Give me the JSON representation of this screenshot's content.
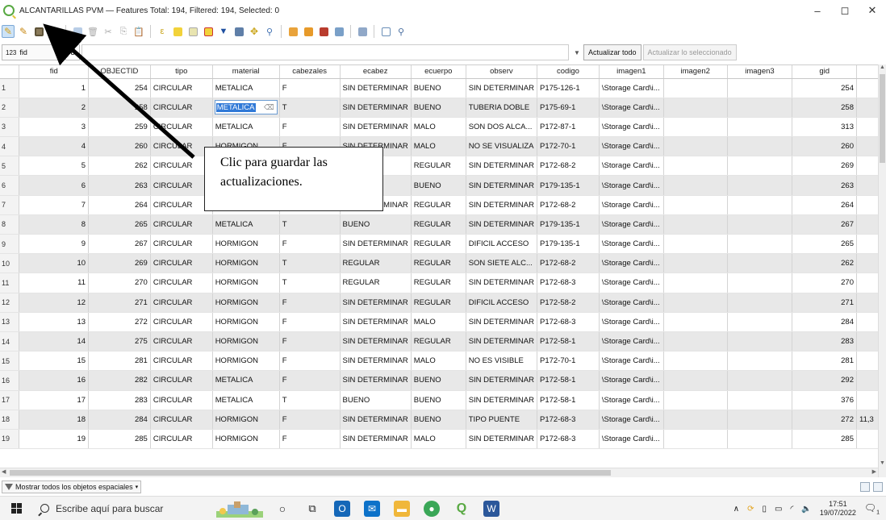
{
  "window": {
    "title": "ALCANTARILLAS PVM — Features Total: 194, Filtered: 194, Selected: 0",
    "minimize": "–",
    "maximize": "◻",
    "close": "✕"
  },
  "expression_bar": {
    "field_type": "123",
    "field_name": "fid",
    "epsilon": "ε",
    "update_all": "Actualizar todo",
    "update_selected": "Actualizar lo seleccionado"
  },
  "table": {
    "columns": [
      "fid",
      "OBJECTID",
      "tipo",
      "material",
      "cabezales",
      "ecabez",
      "ecuerpo",
      "observ",
      "codigo",
      "imagen1",
      "imagen2",
      "imagen3",
      "gid",
      ""
    ],
    "rows": [
      {
        "n": "1",
        "fid": "1",
        "objectid": "254",
        "tipo": "CIRCULAR",
        "material": "METALICA",
        "cabezales": "F",
        "ecabez": "SIN DETERMINAR",
        "ecuerpo": "BUENO",
        "observ": "SIN DETERMINAR",
        "codigo": "P175-126-1",
        "imagen1": "\\Storage Card\\i...",
        "gid": "254",
        "extra": ""
      },
      {
        "n": "2",
        "fid": "2",
        "objectid": "258",
        "tipo": "CIRCULAR",
        "material": "METALICA",
        "cabezales": "T",
        "ecabez": "SIN DETERMINAR",
        "ecuerpo": "BUENO",
        "observ": "TUBERIA DOBLE",
        "codigo": "P175-69-1",
        "imagen1": "\\Storage Card\\i...",
        "gid": "258",
        "extra": ""
      },
      {
        "n": "3",
        "fid": "3",
        "objectid": "259",
        "tipo": "CIRCULAR",
        "material": "METALICA",
        "cabezales": "F",
        "ecabez": "SIN DETERMINAR",
        "ecuerpo": "MALO",
        "observ": "SON DOS ALCA...",
        "codigo": "P172-87-1",
        "imagen1": "\\Storage Card\\i...",
        "gid": "313",
        "extra": ""
      },
      {
        "n": "4",
        "fid": "4",
        "objectid": "260",
        "tipo": "CIRCULAR",
        "material": "HORMIGON",
        "cabezales": "F",
        "ecabez": "SIN DETERMINAR",
        "ecuerpo": "MALO",
        "observ": "NO SE VISUALIZA",
        "codigo": "P172-70-1",
        "imagen1": "\\Storage Card\\i...",
        "gid": "260",
        "extra": ""
      },
      {
        "n": "5",
        "fid": "5",
        "objectid": "262",
        "tipo": "CIRCULAR",
        "material": "",
        "cabezales": "",
        "ecabez": "",
        "ecuerpo": "REGULAR",
        "observ": "SIN DETERMINAR",
        "codigo": "P172-68-2",
        "imagen1": "\\Storage Card\\i...",
        "gid": "269",
        "extra": ""
      },
      {
        "n": "6",
        "fid": "6",
        "objectid": "263",
        "tipo": "CIRCULAR",
        "material": "",
        "cabezales": "",
        "ecabez": "",
        "ecuerpo": "BUENO",
        "observ": "SIN DETERMINAR",
        "codigo": "P179-135-1",
        "imagen1": "\\Storage Card\\i...",
        "gid": "263",
        "extra": ""
      },
      {
        "n": "7",
        "fid": "7",
        "objectid": "264",
        "tipo": "CIRCULAR",
        "material": "",
        "cabezales": "",
        "ecabez": "SIN DETERMINAR",
        "ecuerpo": "REGULAR",
        "observ": "SIN DETERMINAR",
        "codigo": "P172-68-2",
        "imagen1": "\\Storage Card\\i...",
        "gid": "264",
        "extra": ""
      },
      {
        "n": "8",
        "fid": "8",
        "objectid": "265",
        "tipo": "CIRCULAR",
        "material": "METALICA",
        "cabezales": "T",
        "ecabez": "BUENO",
        "ecuerpo": "REGULAR",
        "observ": "SIN DETERMINAR",
        "codigo": "P179-135-1",
        "imagen1": "\\Storage Card\\i...",
        "gid": "267",
        "extra": ""
      },
      {
        "n": "9",
        "fid": "9",
        "objectid": "267",
        "tipo": "CIRCULAR",
        "material": "HORMIGON",
        "cabezales": "F",
        "ecabez": "SIN DETERMINAR",
        "ecuerpo": "REGULAR",
        "observ": "DIFICIL ACCESO",
        "codigo": "P179-135-1",
        "imagen1": "\\Storage Card\\i...",
        "gid": "265",
        "extra": ""
      },
      {
        "n": "10",
        "fid": "10",
        "objectid": "269",
        "tipo": "CIRCULAR",
        "material": "HORMIGON",
        "cabezales": "T",
        "ecabez": "REGULAR",
        "ecuerpo": "REGULAR",
        "observ": "SON SIETE ALC...",
        "codigo": "P172-68-2",
        "imagen1": "\\Storage Card\\i...",
        "gid": "262",
        "extra": ""
      },
      {
        "n": "11",
        "fid": "11",
        "objectid": "270",
        "tipo": "CIRCULAR",
        "material": "HORMIGON",
        "cabezales": "T",
        "ecabez": "REGULAR",
        "ecuerpo": "REGULAR",
        "observ": "SIN DETERMINAR",
        "codigo": "P172-68-3",
        "imagen1": "\\Storage Card\\i...",
        "gid": "270",
        "extra": ""
      },
      {
        "n": "12",
        "fid": "12",
        "objectid": "271",
        "tipo": "CIRCULAR",
        "material": "HORMIGON",
        "cabezales": "F",
        "ecabez": "SIN DETERMINAR",
        "ecuerpo": "REGULAR",
        "observ": "DIFICIL ACCESO",
        "codigo": "P172-58-2",
        "imagen1": "\\Storage Card\\i...",
        "gid": "271",
        "extra": ""
      },
      {
        "n": "13",
        "fid": "13",
        "objectid": "272",
        "tipo": "CIRCULAR",
        "material": "HORMIGON",
        "cabezales": "F",
        "ecabez": "SIN DETERMINAR",
        "ecuerpo": "MALO",
        "observ": "SIN DETERMINAR",
        "codigo": "P172-68-3",
        "imagen1": "\\Storage Card\\i...",
        "gid": "284",
        "extra": ""
      },
      {
        "n": "14",
        "fid": "14",
        "objectid": "275",
        "tipo": "CIRCULAR",
        "material": "HORMIGON",
        "cabezales": "F",
        "ecabez": "SIN DETERMINAR",
        "ecuerpo": "REGULAR",
        "observ": "SIN DETERMINAR",
        "codigo": "P172-58-1",
        "imagen1": "\\Storage Card\\i...",
        "gid": "283",
        "extra": ""
      },
      {
        "n": "15",
        "fid": "15",
        "objectid": "281",
        "tipo": "CIRCULAR",
        "material": "HORMIGON",
        "cabezales": "F",
        "ecabez": "SIN DETERMINAR",
        "ecuerpo": "MALO",
        "observ": "NO ES VISIBLE",
        "codigo": "P172-70-1",
        "imagen1": "\\Storage Card\\i...",
        "gid": "281",
        "extra": ""
      },
      {
        "n": "16",
        "fid": "16",
        "objectid": "282",
        "tipo": "CIRCULAR",
        "material": "METALICA",
        "cabezales": "F",
        "ecabez": "SIN DETERMINAR",
        "ecuerpo": "BUENO",
        "observ": "SIN DETERMINAR",
        "codigo": "P172-58-1",
        "imagen1": "\\Storage Card\\i...",
        "gid": "292",
        "extra": ""
      },
      {
        "n": "17",
        "fid": "17",
        "objectid": "283",
        "tipo": "CIRCULAR",
        "material": "METALICA",
        "cabezales": "T",
        "ecabez": "BUENO",
        "ecuerpo": "BUENO",
        "observ": "SIN DETERMINAR",
        "codigo": "P172-58-1",
        "imagen1": "\\Storage Card\\i...",
        "gid": "376",
        "extra": ""
      },
      {
        "n": "18",
        "fid": "18",
        "objectid": "284",
        "tipo": "CIRCULAR",
        "material": "HORMIGON",
        "cabezales": "F",
        "ecabez": "SIN DETERMINAR",
        "ecuerpo": "BUENO",
        "observ": "TIPO PUENTE",
        "codigo": "P172-68-3",
        "imagen1": "\\Storage Card\\i...",
        "gid": "272",
        "extra": "11,3"
      },
      {
        "n": "19",
        "fid": "19",
        "objectid": "285",
        "tipo": "CIRCULAR",
        "material": "HORMIGON",
        "cabezales": "F",
        "ecabez": "SIN DETERMINAR",
        "ecuerpo": "MALO",
        "observ": "SIN DETERMINAR",
        "codigo": "P172-68-3",
        "imagen1": "\\Storage Card\\i...",
        "gid": "285",
        "extra": ""
      }
    ]
  },
  "status": {
    "filter_label": "Mostrar todos los objetos espaciales"
  },
  "taskbar": {
    "search_placeholder": "Escribe aquí para buscar",
    "time": "17:51",
    "date": "19/07/2022",
    "notification_count": "1"
  },
  "annotation": {
    "text": "Clic para guardar las actualizaciones."
  },
  "colors": {
    "selection": "#3079d7",
    "alt_row": "#e8e8e8",
    "qgis_green": "#58a942"
  }
}
